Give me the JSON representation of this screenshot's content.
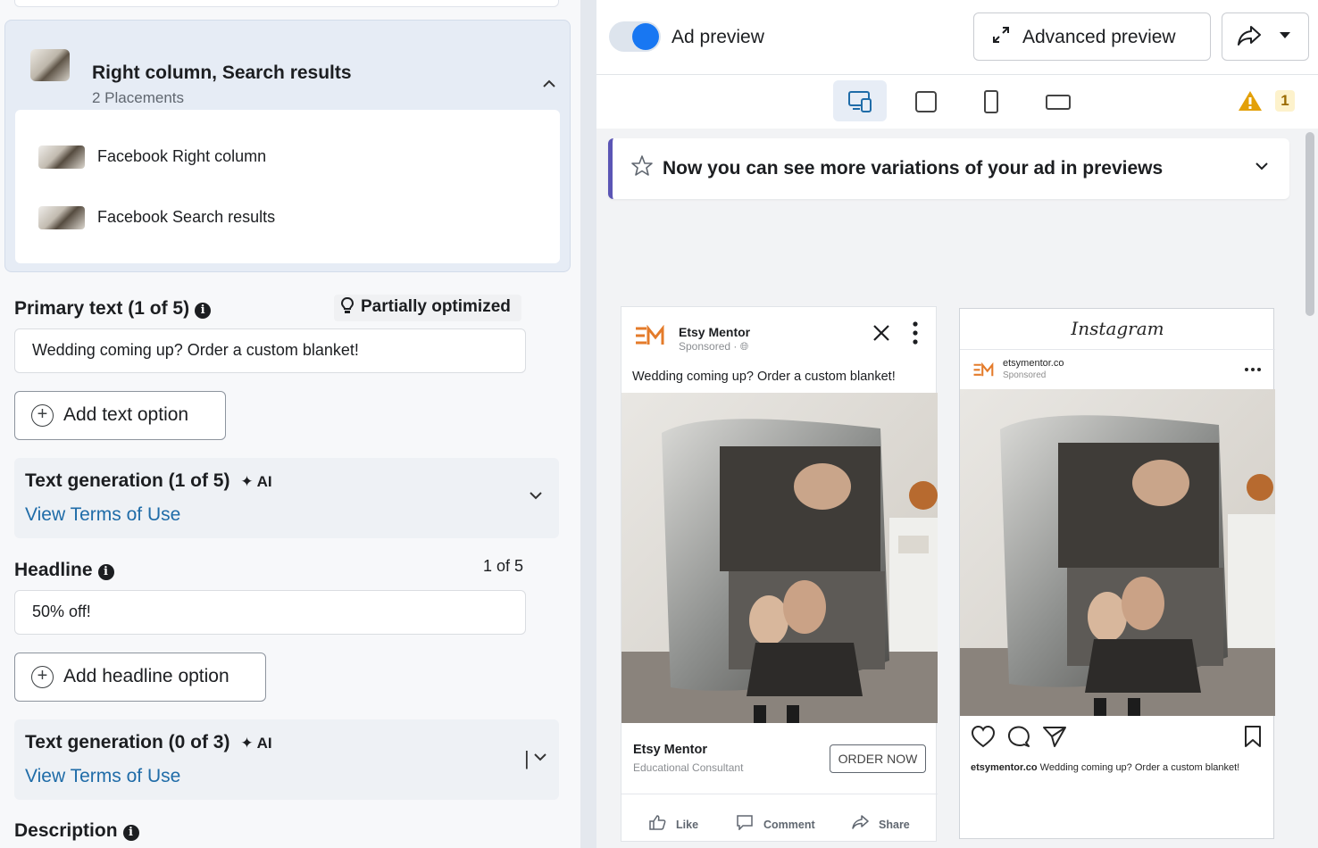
{
  "placement_group": {
    "title": "Right column, Search results",
    "subtitle": "2 Placements",
    "items": [
      {
        "label": "Facebook Right column"
      },
      {
        "label": "Facebook Search results"
      }
    ]
  },
  "primary_text": {
    "label": "Primary text (1 of 5)",
    "badge": "Partially optimized",
    "value": "Wedding coming up? Order a custom blanket!",
    "add_button": "Add text option"
  },
  "text_generation_1": {
    "title": "Text generation (1 of 5)",
    "ai": "AI",
    "link": "View Terms of Use"
  },
  "headline": {
    "label": "Headline",
    "count": "1 of 5",
    "value": "50% off!",
    "add_button": "Add headline option"
  },
  "text_generation_2": {
    "title": "Text generation (0 of 3)",
    "ai": "AI",
    "link": "View Terms of Use"
  },
  "description": {
    "label": "Description"
  },
  "preview": {
    "toggle_label": "Ad preview",
    "toggle_on": true,
    "advanced_button": "Advanced preview",
    "warning_count": "1",
    "notice": "Now you can see more variations of your ad in previews"
  },
  "fb_ad": {
    "page_name": "Etsy Mentor",
    "sponsored": "Sponsored · ",
    "text": "Wedding coming up? Order a custom blanket!",
    "footer_name": "Etsy Mentor",
    "footer_sub": "Educational Consultant",
    "cta": "ORDER NOW",
    "actions": [
      "Like",
      "Comment",
      "Share"
    ]
  },
  "ig_ad": {
    "logo": "Instagram",
    "handle": "etsymentor.co",
    "sponsored": "Sponsored",
    "caption_handle": "etsymentor.co",
    "caption_text": "Wedding coming up? Order a custom blanket!"
  },
  "colors": {
    "accent": "#1877f2",
    "link": "#1f6ca8",
    "notice_bar": "#5b55b5",
    "warning": "#e3a008",
    "brand_logo": "#e47b2a"
  }
}
